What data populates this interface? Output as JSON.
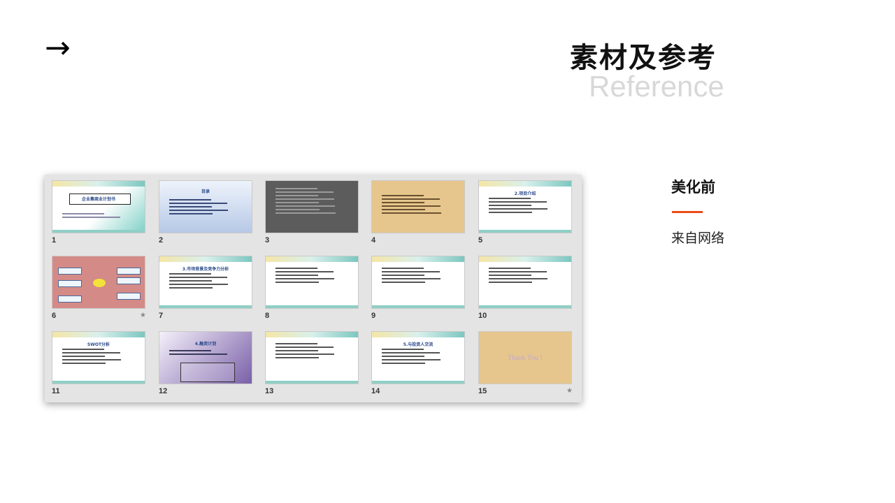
{
  "header": {
    "arrow": "→",
    "title": "素材及参考",
    "subtitle": "Reference"
  },
  "slides": [
    {
      "num": "1",
      "style": "cover",
      "title": "企业集商业计划书"
    },
    {
      "num": "2",
      "style": "toc",
      "title": "目录"
    },
    {
      "num": "3",
      "style": "gray"
    },
    {
      "num": "4",
      "style": "tan"
    },
    {
      "num": "5",
      "style": "content",
      "title": "2.项目介绍"
    },
    {
      "num": "6",
      "style": "red",
      "starred": true
    },
    {
      "num": "7",
      "style": "content",
      "title": "3.市场背景及竞争力分析"
    },
    {
      "num": "8",
      "style": "content"
    },
    {
      "num": "9",
      "style": "content"
    },
    {
      "num": "10",
      "style": "content"
    },
    {
      "num": "11",
      "style": "content",
      "title": "SWOT分析"
    },
    {
      "num": "12",
      "style": "purple",
      "title": "4.融资计划"
    },
    {
      "num": "13",
      "style": "content"
    },
    {
      "num": "14",
      "style": "content",
      "title": "5.与投资人交流"
    },
    {
      "num": "15",
      "style": "thanks",
      "starred": true,
      "title": "Thank You !"
    }
  ],
  "info": {
    "heading": "美化前",
    "source": "来自网络"
  },
  "colors": {
    "accent": "#ef4b18",
    "subtitle_gray": "#d8d8d8",
    "panel_bg": "#e4e4e4"
  }
}
